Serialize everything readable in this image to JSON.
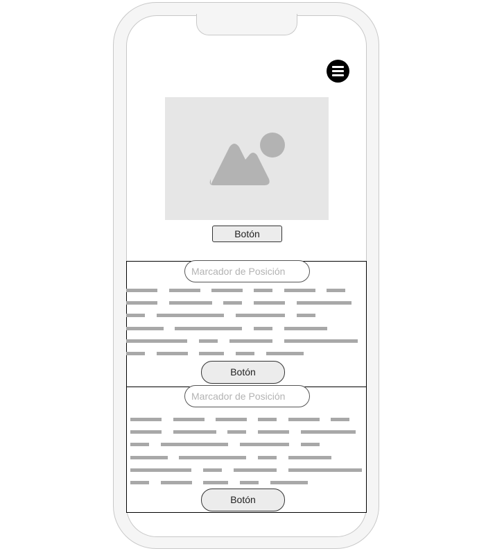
{
  "header": {
    "menu_icon": "hamburger-menu-icon"
  },
  "hero": {
    "image_icon": "image-placeholder-icon",
    "button_label": "Botón"
  },
  "sections": [
    {
      "input_placeholder": "Marcador de Posición",
      "button_label": "Botón"
    },
    {
      "input_placeholder": "Marcador de Posición",
      "button_label": "Botón"
    }
  ],
  "colors": {
    "placeholder_bg": "#e6e6e6",
    "text_line": "#a8a8a8",
    "menu_button": "#000000",
    "button_bg": "#ececec"
  }
}
